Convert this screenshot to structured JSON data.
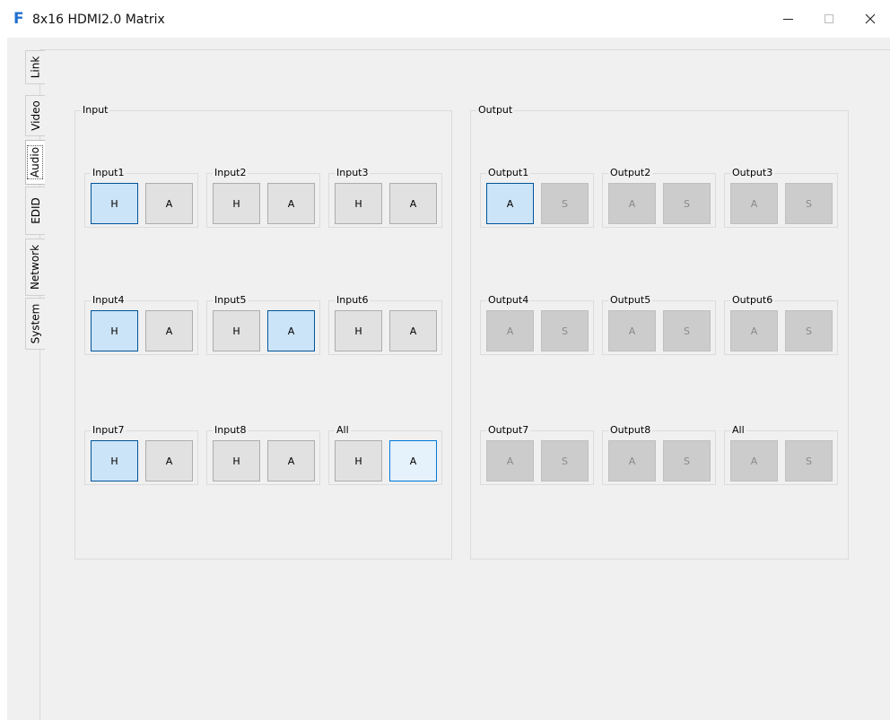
{
  "window": {
    "logo": "F",
    "title": "8x16 HDMI2.0 Matrix"
  },
  "tabs": [
    {
      "label": "Link",
      "active": false
    },
    {
      "label": "Video",
      "active": false
    },
    {
      "label": "Audio",
      "active": true
    },
    {
      "label": "EDID",
      "active": false
    },
    {
      "label": "Network",
      "active": false
    },
    {
      "label": "System",
      "active": false
    }
  ],
  "input_group": {
    "title": "Input",
    "cells": [
      {
        "title": "Input1",
        "buttons": [
          {
            "label": "H",
            "state": "selected"
          },
          {
            "label": "A",
            "state": "normal"
          }
        ]
      },
      {
        "title": "Input2",
        "buttons": [
          {
            "label": "H",
            "state": "normal"
          },
          {
            "label": "A",
            "state": "normal"
          }
        ]
      },
      {
        "title": "Input3",
        "buttons": [
          {
            "label": "H",
            "state": "normal"
          },
          {
            "label": "A",
            "state": "normal"
          }
        ]
      },
      {
        "title": "Input4",
        "buttons": [
          {
            "label": "H",
            "state": "selected"
          },
          {
            "label": "A",
            "state": "normal"
          }
        ]
      },
      {
        "title": "Input5",
        "buttons": [
          {
            "label": "H",
            "state": "normal"
          },
          {
            "label": "A",
            "state": "selected"
          }
        ]
      },
      {
        "title": "Input6",
        "buttons": [
          {
            "label": "H",
            "state": "normal"
          },
          {
            "label": "A",
            "state": "normal"
          }
        ]
      },
      {
        "title": "Input7",
        "buttons": [
          {
            "label": "H",
            "state": "selected"
          },
          {
            "label": "A",
            "state": "normal"
          }
        ]
      },
      {
        "title": "Input8",
        "buttons": [
          {
            "label": "H",
            "state": "normal"
          },
          {
            "label": "A",
            "state": "normal"
          }
        ]
      },
      {
        "title": "All",
        "buttons": [
          {
            "label": "H",
            "state": "normal"
          },
          {
            "label": "A",
            "state": "hover"
          }
        ]
      }
    ]
  },
  "output_group": {
    "title": "Output",
    "cells": [
      {
        "title": "Output1",
        "buttons": [
          {
            "label": "A",
            "state": "selected"
          },
          {
            "label": "S",
            "state": "disabled"
          }
        ]
      },
      {
        "title": "Output2",
        "buttons": [
          {
            "label": "A",
            "state": "disabled"
          },
          {
            "label": "S",
            "state": "disabled"
          }
        ]
      },
      {
        "title": "Output3",
        "buttons": [
          {
            "label": "A",
            "state": "disabled"
          },
          {
            "label": "S",
            "state": "disabled"
          }
        ]
      },
      {
        "title": "Output4",
        "buttons": [
          {
            "label": "A",
            "state": "disabled"
          },
          {
            "label": "S",
            "state": "disabled"
          }
        ]
      },
      {
        "title": "Output5",
        "buttons": [
          {
            "label": "A",
            "state": "disabled"
          },
          {
            "label": "S",
            "state": "disabled"
          }
        ]
      },
      {
        "title": "Output6",
        "buttons": [
          {
            "label": "A",
            "state": "disabled"
          },
          {
            "label": "S",
            "state": "disabled"
          }
        ]
      },
      {
        "title": "Output7",
        "buttons": [
          {
            "label": "A",
            "state": "disabled"
          },
          {
            "label": "S",
            "state": "disabled"
          }
        ]
      },
      {
        "title": "Output8",
        "buttons": [
          {
            "label": "A",
            "state": "disabled"
          },
          {
            "label": "S",
            "state": "disabled"
          }
        ]
      },
      {
        "title": "All",
        "buttons": [
          {
            "label": "A",
            "state": "disabled"
          },
          {
            "label": "S",
            "state": "disabled"
          }
        ]
      }
    ]
  },
  "colors": {
    "selected_fill": "#cce4f7",
    "selected_border": "#005499",
    "hover_fill": "#e5f1fb",
    "disabled_fill": "#cccccc",
    "logo": "#1f6fd0"
  }
}
